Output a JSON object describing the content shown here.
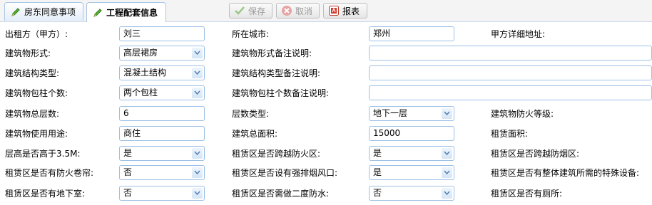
{
  "tabs": [
    {
      "label": "房东同意事项",
      "active": false
    },
    {
      "label": "工程配套信息",
      "active": true
    }
  ],
  "toolbar": {
    "save_label": "保存",
    "cancel_label": "取消",
    "report_label": "报表"
  },
  "form": {
    "lessor_label": "出租方（甲方）:",
    "lessor_value": "刘三",
    "city_label": "所在城市:",
    "city_value": "郑州",
    "party_a_address_label": "甲方详细地址:",
    "building_form_label": "建筑物形式:",
    "building_form_value": "高层裙房",
    "building_form_note_label": "建筑物形式备注说明:",
    "building_form_note_value": "",
    "structure_type_label": "建筑结构类型:",
    "structure_type_value": "混凝土结构",
    "structure_type_note_label": "建筑结构类型备注说明:",
    "structure_type_note_value": "",
    "column_count_label": "建筑物包柱个数:",
    "column_count_value": "两个包柱",
    "column_count_note_label": "建筑物包柱个数备注说明:",
    "column_count_note_value": "",
    "total_floors_label": "建筑物总层数:",
    "total_floors_value": "6",
    "floor_type_label": "层数类型:",
    "floor_type_value": "地下一层",
    "fire_rating_label": "建筑物防火等级:",
    "usage_label": "建筑物使用用途:",
    "usage_value": "商住",
    "total_area_label": "建筑总面积:",
    "total_area_value": "15000",
    "lease_area_label": "租赁面积:",
    "height_over_label": "层高是否高于3.5M:",
    "height_over_value": "是",
    "cross_fire_zone_label": "租赁区是否跨越防火区:",
    "cross_fire_zone_value": "是",
    "cross_smoke_zone_label": "租赁区是否跨越防烟区:",
    "fire_shutter_label": "租赁区是否有防火卷帘:",
    "fire_shutter_value": "否",
    "exhaust_outlet_label": "租赁区是否设有强排烟风口:",
    "exhaust_outlet_value": "是",
    "special_equipment_label": "租赁区是否有整体建筑所需的特殊设备:",
    "basement_label": "租赁区是否有地下室:",
    "basement_value": "否",
    "secondary_waterproof_label": "租赁区是否需做二度防水:",
    "secondary_waterproof_value": "否",
    "toilet_label": "租赁区是否有厕所:"
  }
}
